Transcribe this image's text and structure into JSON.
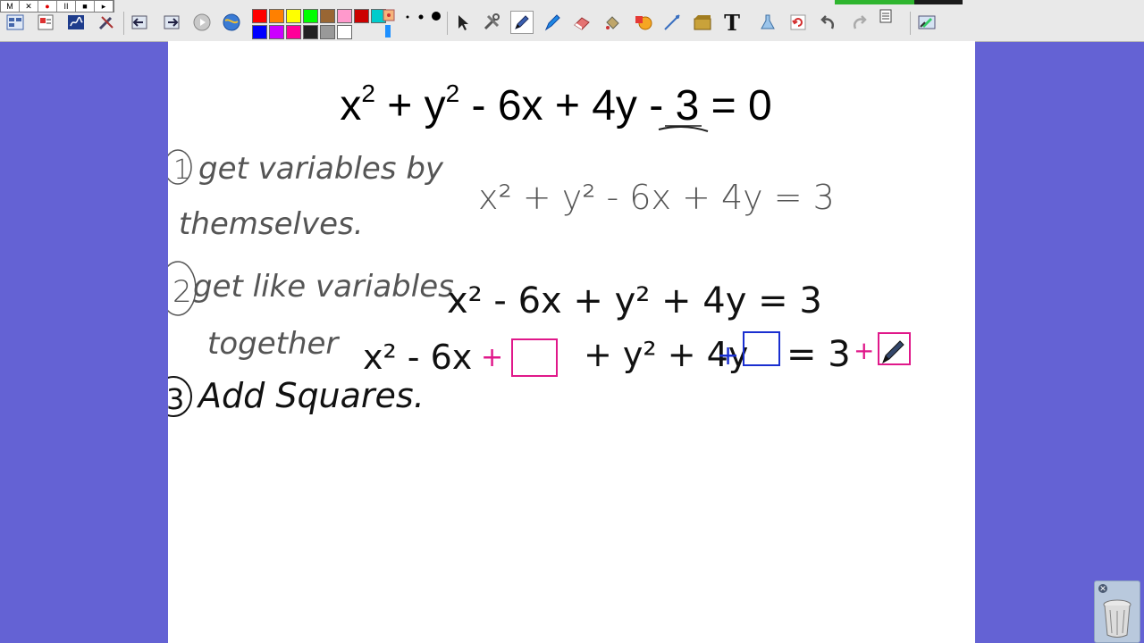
{
  "recorder": {
    "buttons": [
      {
        "name": "minimize",
        "glyph": "M"
      },
      {
        "name": "close",
        "glyph": "✕"
      },
      {
        "name": "record",
        "glyph": "●"
      },
      {
        "name": "pause",
        "glyph": "II"
      },
      {
        "name": "stop",
        "glyph": "■"
      },
      {
        "name": "play",
        "glyph": "▸"
      }
    ]
  },
  "toolbar": {
    "text_tool_glyph": "T",
    "palette": [
      "#ff0000",
      "#ff8000",
      "#ffff00",
      "#00ff00",
      "#996633",
      "#ff99cc",
      "#cc0000",
      "#00cccc",
      "#0000ff",
      "#cc00ff",
      "#ff0099",
      "#222222",
      "#999999",
      "#ffffff"
    ],
    "progress": 0.62
  },
  "whiteboard": {
    "equation": {
      "terms": [
        "x",
        "2",
        " + y",
        "2",
        " - 6x + 4y - ",
        "3",
        " = 0"
      ]
    },
    "handwriting": {
      "step1_label": "1",
      "step1_text_line1": "get variables by",
      "step1_text_line2": "themselves.",
      "step1_math": "x² + y² - 6x + 4y  = 3",
      "step2_label": "2",
      "step2_text_line1": "get like variables",
      "step2_text_line2": "together",
      "step2_math": "x² - 6x  + y² + 4y  = 3",
      "step3_label": "3",
      "step3_text": "Add Squares.",
      "step3_math_left": "x² - 6x",
      "step3_plus_pink": "+",
      "step3_math_mid": "+ y² + 4y",
      "step3_plus_blue": "+",
      "step3_math_right": "= 3",
      "step3_plus_pink2": "+"
    },
    "colors": {
      "ink": "#111111",
      "gray_ink": "#555555",
      "pink": "#e0188a",
      "blue": "#1a2fd0"
    }
  },
  "trash": {
    "icon": "trash-icon"
  }
}
